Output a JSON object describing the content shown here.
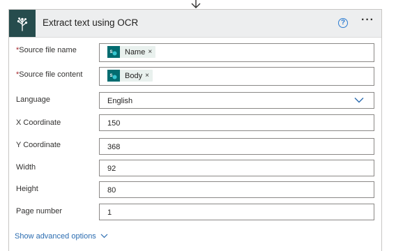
{
  "card": {
    "title": "Extract text using OCR",
    "help_symbol": "?",
    "more_symbol": "···",
    "action_icon": "ai-builder-tree-icon"
  },
  "fields": {
    "source_file_name": {
      "label": "Source file name",
      "required": true,
      "token": "Name",
      "token_icon": "sharepoint-icon",
      "remove_symbol": "×"
    },
    "source_file_content": {
      "label": "Source file content",
      "required": true,
      "token": "Body",
      "token_icon": "sharepoint-icon",
      "remove_symbol": "×"
    },
    "language": {
      "label": "Language",
      "value": "English"
    },
    "x_coordinate": {
      "label": "X Coordinate",
      "value": "150"
    },
    "y_coordinate": {
      "label": "Y Coordinate",
      "value": "368"
    },
    "width": {
      "label": "Width",
      "value": "92"
    },
    "height": {
      "label": "Height",
      "value": "80"
    },
    "page_number": {
      "label": "Page number",
      "value": "1"
    }
  },
  "advanced": {
    "label": "Show advanced options"
  },
  "colors": {
    "header_bg": "#edeeef",
    "icon_bg": "#264c4d",
    "link": "#2b6cb0",
    "required": "#a4262c",
    "token_bg": "#e9f1ee"
  }
}
